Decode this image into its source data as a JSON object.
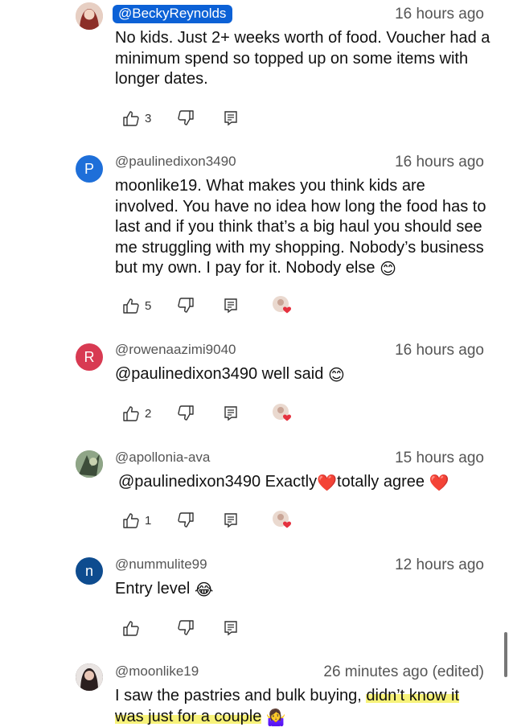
{
  "comments": [
    {
      "handle": "@BeckyReynolds",
      "time": "16 hours ago",
      "text": "No kids. Just 2+ weeks worth of food. Voucher had a minimum spend so topped up on some items with longer dates.",
      "likes": "3",
      "avatar_letter": "",
      "avatar_color": "#b5594e"
    },
    {
      "handle": "@paulinedixon3490",
      "time": "16 hours ago",
      "text": "moonlike19.  What makes you think kids are involved.  You have no idea how long the food has to last and if you think that’s a big haul you should see me struggling with my shopping.  Nobody’s business but my own. I pay for it. Nobody else",
      "emoji": "😊",
      "likes": "5",
      "avatar_letter": "P",
      "avatar_color": "#1e6fd9"
    },
    {
      "handle": "@rowenaazimi9040",
      "time": "16 hours ago",
      "text": "@paulinedixon3490 well said",
      "emoji": "😊",
      "likes": "2",
      "avatar_letter": "R",
      "avatar_color": "#d83a52"
    },
    {
      "handle": "@apollonia-ava",
      "time": "15 hours ago",
      "text_a": "@paulinedixon3490 Exactly",
      "emoji_a": "❤️",
      "text_b": "totally agree",
      "emoji_b": "❤️",
      "likes": "1",
      "avatar_letter": "",
      "avatar_color": "#6f8a6c"
    },
    {
      "handle": "@nummulite99",
      "time": "12 hours ago",
      "text": "Entry level",
      "emoji": "😂",
      "likes": "",
      "avatar_letter": "n",
      "avatar_color": "#0e4c8f"
    },
    {
      "handle": "@moonlike19",
      "time": "26 minutes ago (edited)",
      "text_a": "I saw the pastries and bulk buying,",
      "text_b": "didn’t know",
      "text_c": " it",
      "text_d": "was just for a couple",
      "emoji": "🤷‍♀️",
      "avatar_letter": "",
      "avatar_color": "#3b3030"
    }
  ]
}
